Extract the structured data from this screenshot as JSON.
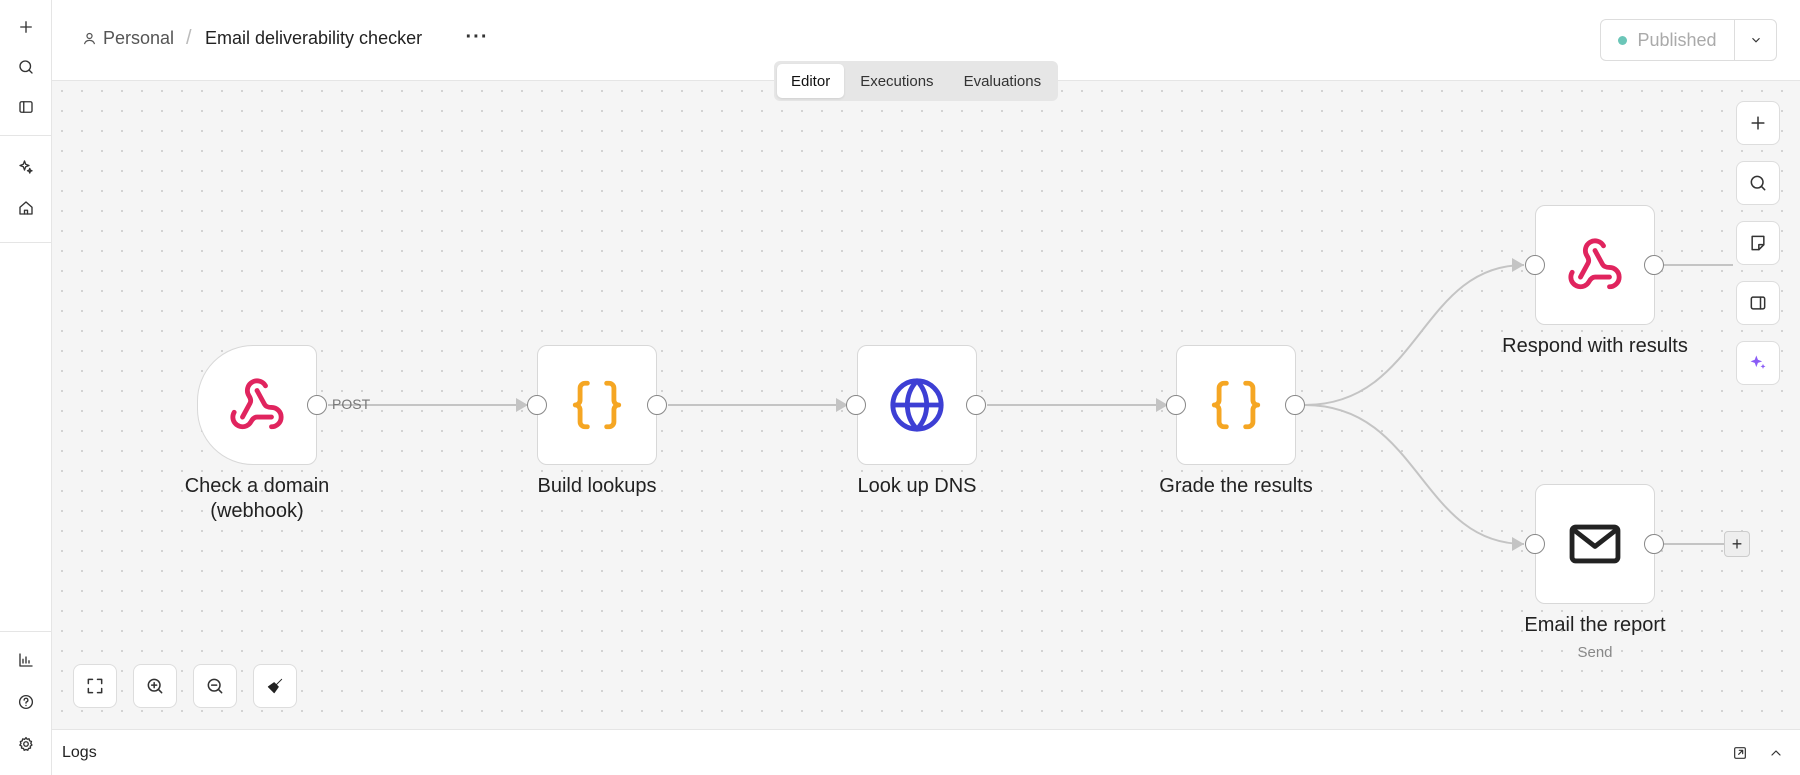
{
  "header": {
    "breadcrumb_project": "Personal",
    "breadcrumb_separator": "/",
    "workflow_title": "Email deliverability checker",
    "more_label": "···",
    "publish_label": "Published"
  },
  "tabs": [
    {
      "label": "Editor",
      "active": true
    },
    {
      "label": "Executions",
      "active": false
    },
    {
      "label": "Evaluations",
      "active": false
    }
  ],
  "nodes": {
    "webhook_trigger": {
      "label_line1": "Check a domain",
      "label_line2": "(webhook)",
      "icon": "webhook-icon",
      "icon_color": "#e0245e"
    },
    "build_lookups": {
      "label": "Build lookups",
      "icon": "code-braces-icon",
      "icon_color": "#f5a623"
    },
    "lookup_dns": {
      "label": "Look up DNS",
      "icon": "globe-icon",
      "icon_color": "#3d3fd4"
    },
    "grade_results": {
      "label": "Grade the results",
      "icon": "code-braces-icon",
      "icon_color": "#f5a623"
    },
    "respond_results": {
      "label": "Respond with results",
      "icon": "webhook-icon",
      "icon_color": "#e0245e"
    },
    "email_report": {
      "label": "Email the report",
      "sublabel": "Send",
      "icon": "envelope-icon",
      "icon_color": "#222222"
    }
  },
  "edge_labels": {
    "trigger_output": "POST"
  },
  "add_node_glyph": "+",
  "logs": {
    "title": "Logs"
  },
  "colors": {
    "canvas_bg": "#f5f5f5",
    "edge": "#c4c4c4",
    "publish_dot": "#6bc6b8"
  }
}
